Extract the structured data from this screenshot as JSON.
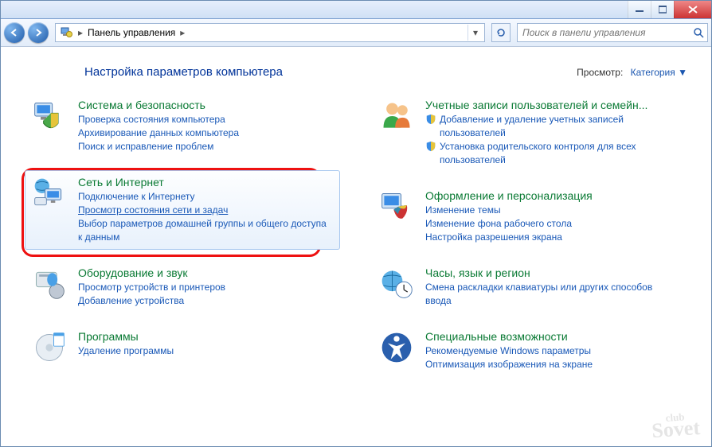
{
  "breadcrumb": {
    "root": "Панель управления"
  },
  "search": {
    "placeholder": "Поиск в панели управления"
  },
  "heading": "Настройка параметров компьютера",
  "view": {
    "label": "Просмотр:",
    "value": "Категория"
  },
  "left": [
    {
      "title": "Система и безопасность",
      "links": [
        "Проверка состояния компьютера",
        "Архивирование данных компьютера",
        "Поиск и исправление проблем"
      ]
    },
    {
      "title": "Сеть и Интернет",
      "links": [
        "Подключение к Интернету",
        "Просмотр состояния сети и задач",
        "Выбор параметров домашней группы и общего доступа к данным"
      ]
    },
    {
      "title": "Оборудование и звук",
      "links": [
        "Просмотр устройств и принтеров",
        "Добавление устройства"
      ]
    },
    {
      "title": "Программы",
      "links": [
        "Удаление программы"
      ]
    }
  ],
  "right": [
    {
      "title": "Учетные записи пользователей и семейн...",
      "shielded": [
        "Добавление и удаление учетных записей пользователей",
        "Установка родительского контроля для всех пользователей"
      ]
    },
    {
      "title": "Оформление и персонализация",
      "links": [
        "Изменение темы",
        "Изменение фона рабочего стола",
        "Настройка разрешения экрана"
      ]
    },
    {
      "title": "Часы, язык и регион",
      "links": [
        "Смена раскладки клавиатуры или других способов ввода"
      ]
    },
    {
      "title": "Специальные возможности",
      "links": [
        "Рекомендуемые Windows параметры",
        "Оптимизация изображения на экране"
      ]
    }
  ],
  "watermark": {
    "small": "club",
    "big": "Sovet"
  }
}
